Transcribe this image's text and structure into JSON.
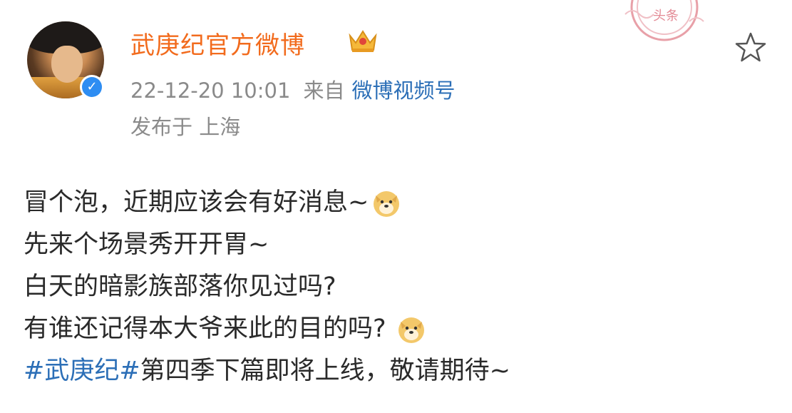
{
  "post": {
    "author": {
      "name": "武庚纪官方微博",
      "avatar_icon": "avatar",
      "verified_icon": "verified-badge-icon",
      "crown_icon": "crown-icon"
    },
    "time": "22-12-20 10:01",
    "from_label": "来自",
    "source": "微博视频号",
    "location": "发布于 上海",
    "stamp_text": "头条",
    "lines": [
      {
        "text": "冒个泡，近期应该会有好消息~",
        "emoji": "doge-emoji"
      },
      {
        "text": "先来个场景秀开开胃~"
      },
      {
        "text": "白天的暗影族部落你见过吗?"
      },
      {
        "text": "有谁还记得本大爷来此的目的吗?",
        "emoji": "doge-emoji"
      },
      {
        "hashtag": "#武庚纪#",
        "text": "第四季下篇即将上线，敬请期待~"
      }
    ]
  },
  "colors": {
    "username": "#f26b1d",
    "link": "#2c6fb7",
    "meta": "#8a8a8a",
    "verified": "#2e8df2"
  }
}
